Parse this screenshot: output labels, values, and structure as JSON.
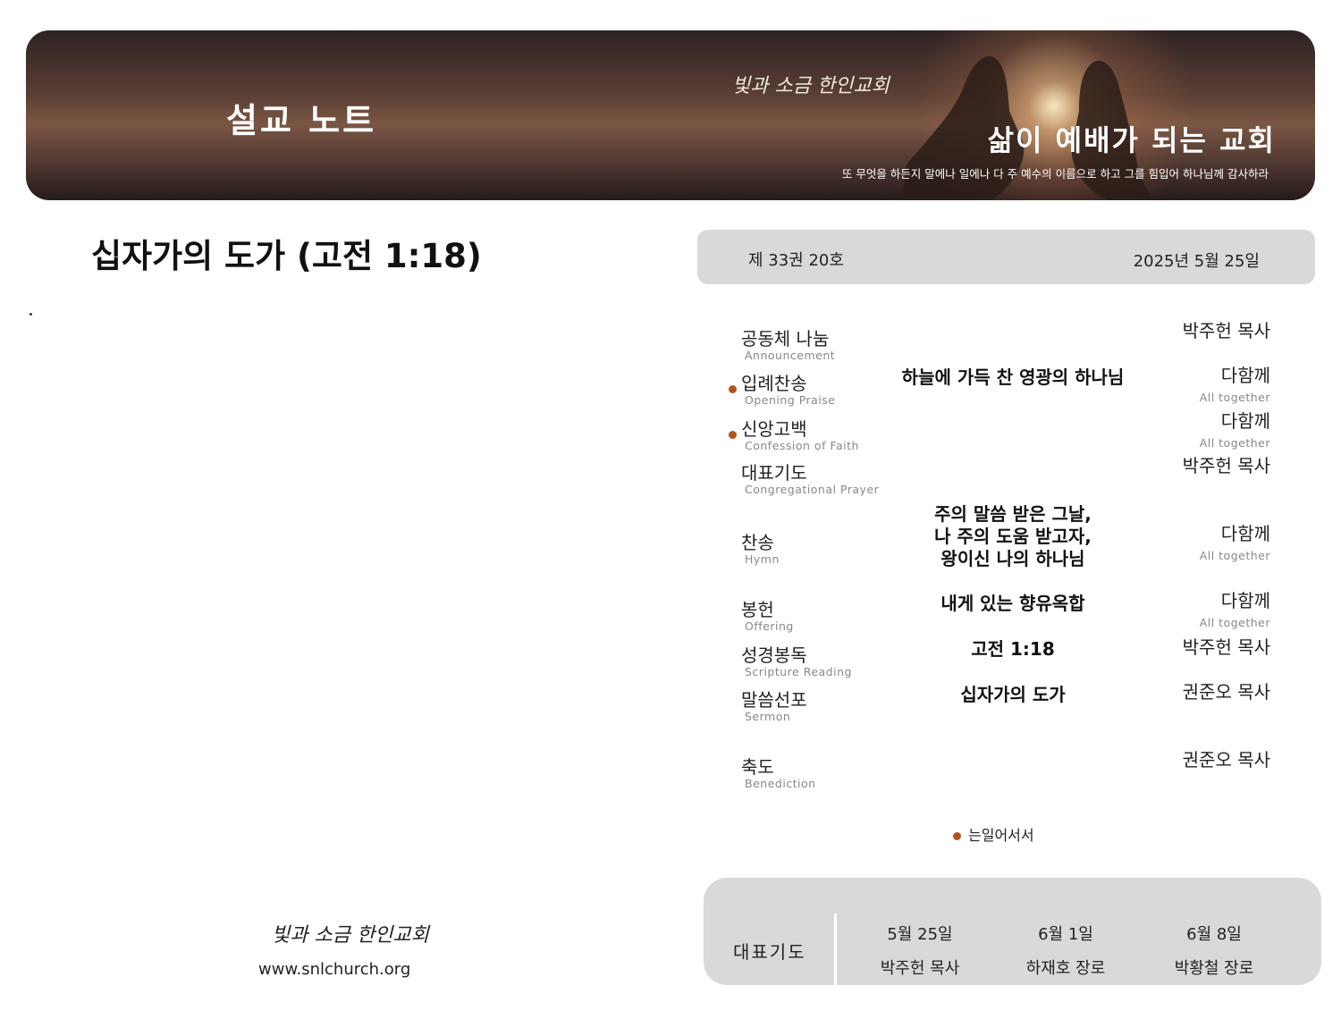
{
  "banner": {
    "title": "설교 노트",
    "logo_text": "빛과 소금 한인교회",
    "slogan": "삶이 예배가 되는 교회",
    "verse": "또 무엇을 하든지 말에나 일에나 다 주 예수의 이름으로 하고 그를 힘입어 하나님께 감사하라"
  },
  "sermon_title": "십자가의 도가 (고전 1:18)",
  "issue": {
    "volume": "제 33권 20호",
    "date": "2025년 5월 25일"
  },
  "service_items": [
    {
      "kr": "공동체 나눔",
      "en": "Announcement",
      "stand": false,
      "content": [],
      "leader": "박주헌 목사",
      "leader_en": ""
    },
    {
      "kr": "입례찬송",
      "en": "Opening Praise",
      "stand": true,
      "content": [
        "하늘에 가득 찬 영광의 하나님"
      ],
      "leader": "다함께",
      "leader_en": "All together"
    },
    {
      "kr": "신앙고백",
      "en": "Confession of Faith",
      "stand": true,
      "content": [],
      "leader": "다함께",
      "leader_en": "All together"
    },
    {
      "kr": "대표기도",
      "en": "Congregational Prayer",
      "stand": false,
      "content": [],
      "leader": "박주헌 목사",
      "leader_en": ""
    },
    {
      "kr": "찬송",
      "en": "Hymn",
      "stand": false,
      "content": [
        "주의 말씀 받은 그날,",
        "나 주의 도움 받고자,",
        "왕이신 나의 하나님"
      ],
      "leader": "다함께",
      "leader_en": "All together"
    },
    {
      "kr": "봉헌",
      "en": "Offering",
      "stand": false,
      "content": [
        "내게 있는 향유옥합"
      ],
      "leader": "다함께",
      "leader_en": "All together"
    },
    {
      "kr": "성경봉독",
      "en": "Scripture Reading",
      "stand": false,
      "content": [
        "고전 1:18"
      ],
      "leader": "박주헌 목사",
      "leader_en": ""
    },
    {
      "kr": "말씀선포",
      "en": "Sermon",
      "stand": false,
      "content": [
        "십자가의 도가"
      ],
      "leader": "권준오 목사",
      "leader_en": ""
    },
    {
      "kr": "축도",
      "en": "Benediction",
      "stand": false,
      "content": [],
      "leader": "권준오 목사",
      "leader_en": ""
    }
  ],
  "legend": {
    "text": "는일어서서",
    "color": "#b4521c"
  },
  "prayer_schedule": {
    "label": "대표기도",
    "entries": [
      {
        "date": "5월 25일",
        "person": "박주헌 목사"
      },
      {
        "date": "6월 1일",
        "person": "하재호 장로"
      },
      {
        "date": "6월 8일",
        "person": "박황철 장로"
      }
    ]
  },
  "footer": {
    "logo_text": "빛과 소금 한인교회",
    "url": "www.snlchurch.org"
  }
}
